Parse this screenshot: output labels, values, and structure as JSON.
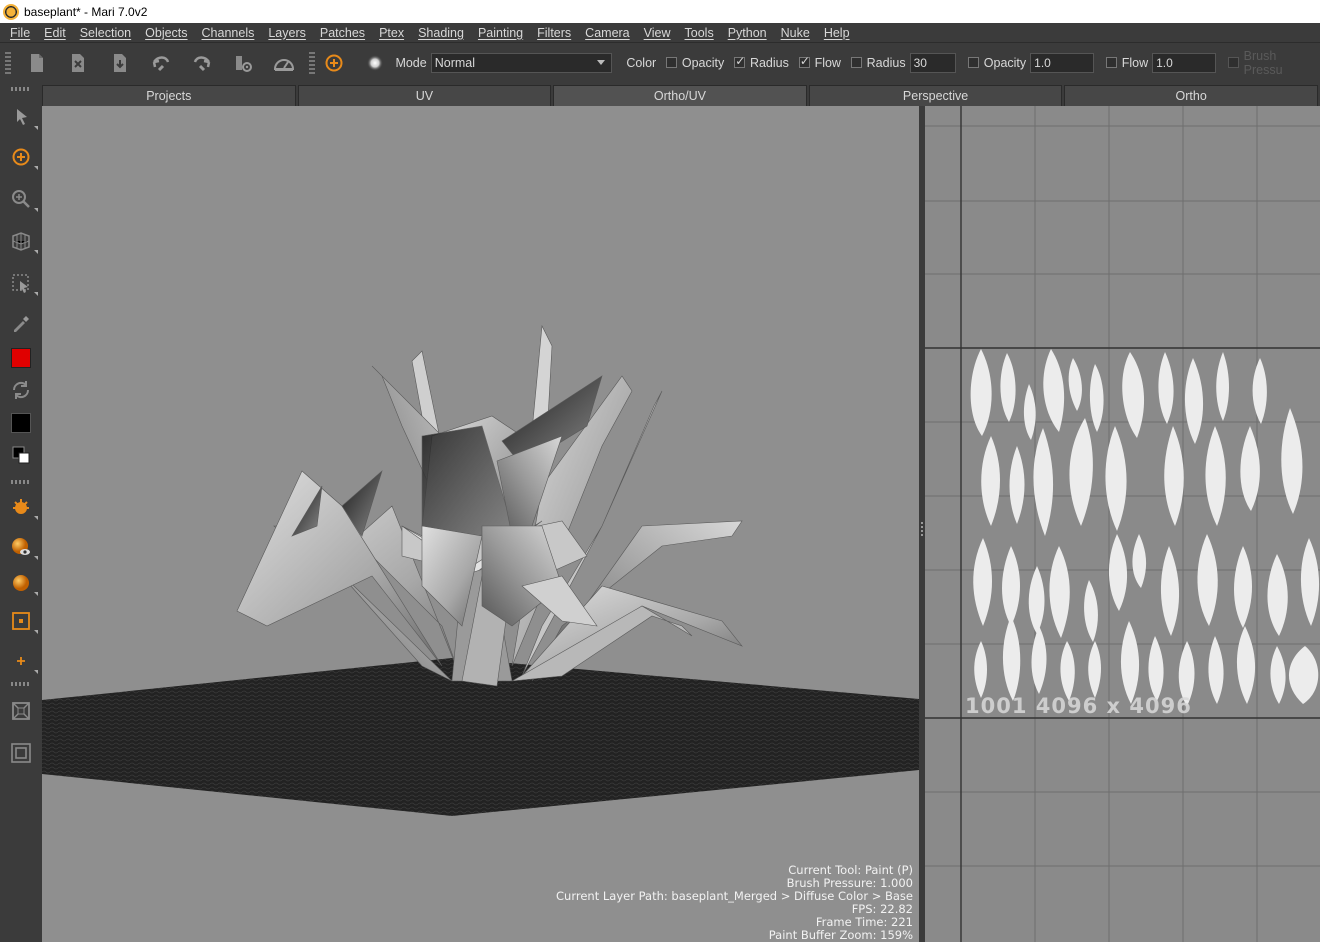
{
  "window": {
    "title": "baseplant* - Mari 7.0v2"
  },
  "menu": [
    "File",
    "Edit",
    "Selection",
    "Objects",
    "Channels",
    "Layers",
    "Patches",
    "Ptex",
    "Shading",
    "Painting",
    "Filters",
    "Camera",
    "View",
    "Tools",
    "Python",
    "Nuke",
    "Help"
  ],
  "toolbar": {
    "mode_label": "Mode",
    "mode_value": "Normal",
    "color_label": "Color",
    "opacity1_label": "Opacity",
    "radius1_label": "Radius",
    "flow1_label": "Flow",
    "radius2_label": "Radius",
    "radius2_value": "30",
    "opacity2_label": "Opacity",
    "opacity2_value": "1.0",
    "flow2_label": "Flow",
    "flow2_value": "1.0",
    "brush_pressure_label": "Brush Pressu"
  },
  "tabs": [
    "Projects",
    "UV",
    "Ortho/UV",
    "Perspective",
    "Ortho"
  ],
  "palette": {
    "primary_color": "#e00000",
    "secondary_color": "#000000"
  },
  "hud": {
    "current_tool": "Current Tool: Paint (P)",
    "brush_pressure": "Brush Pressure: 1.000",
    "layer_path": "Current Layer Path: baseplant_Merged > Diffuse Color > Base",
    "fps": "FPS: 22.82",
    "frame_time": "Frame Time: 221",
    "paint_buffer_zoom": "Paint Buffer Zoom: 159%"
  },
  "uv": {
    "tile_label": "1001  4096 x 4096"
  },
  "colors": {
    "accent": "#e88a1a",
    "viewport_bg": "#8f8f8f",
    "ui_bg": "#3b3b3b"
  }
}
